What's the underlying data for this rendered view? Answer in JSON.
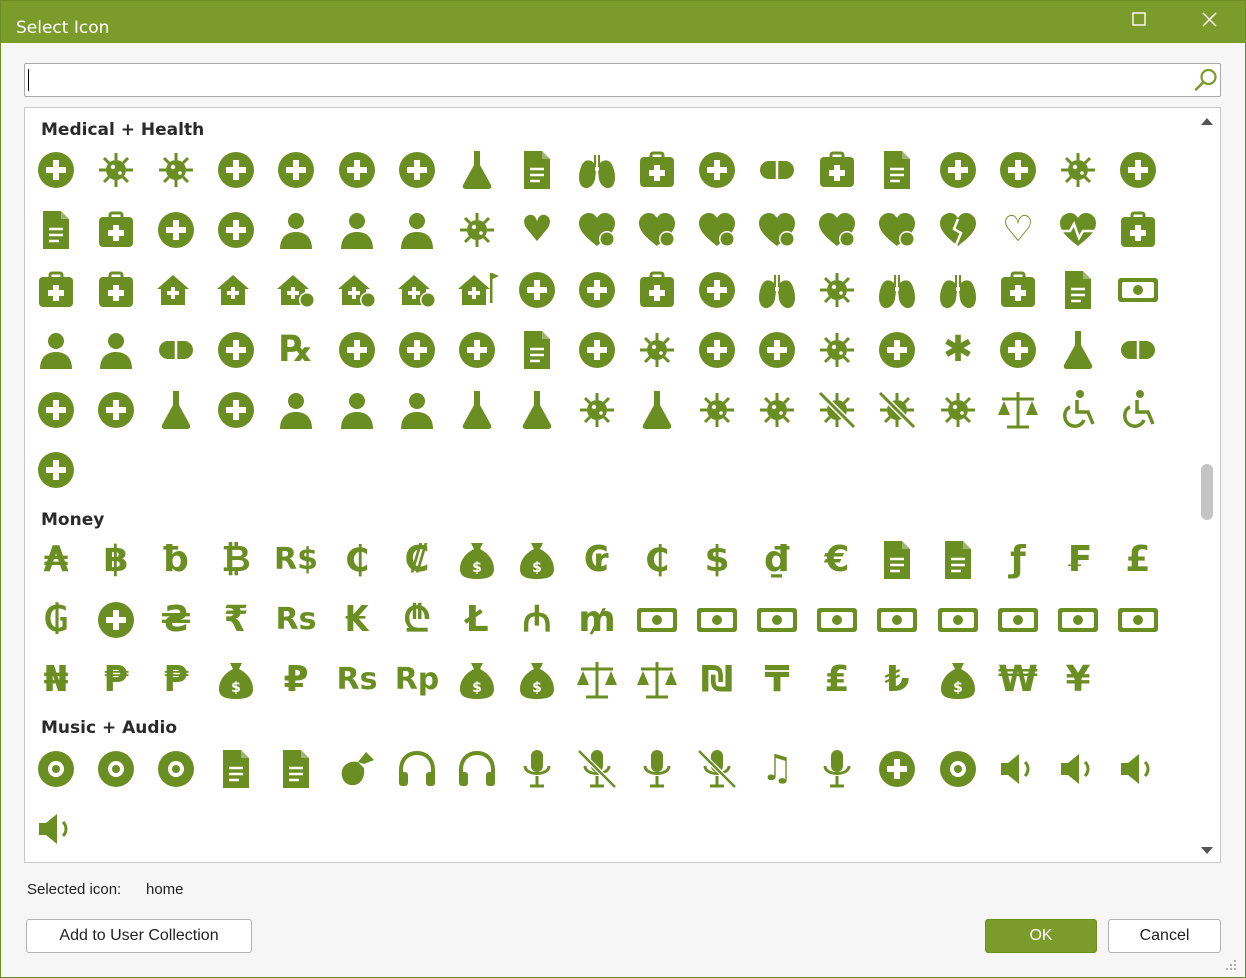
{
  "window": {
    "title": "Select Icon"
  },
  "search": {
    "value": "",
    "placeholder": ""
  },
  "colors": {
    "accent": "#7b9b2a",
    "icon": "#6b8e23"
  },
  "sections": [
    {
      "title": "Medical + Health",
      "icons": [
        "ambulance",
        "bacteria",
        "bacterium",
        "ban-smoking",
        "band-aid",
        "bed-pulse",
        "biohazard",
        "flask-vial",
        "book-medical",
        "brain",
        "briefcase-medical",
        "cannabis",
        "capsules",
        "hospital-h-circle",
        "clipboard-user",
        "comment-medical",
        "crutch",
        "virus-star",
        "dna",
        "file-prescription",
        "square-h",
        "hand-dots",
        "hand-holding-medical",
        "head-side-cough",
        "head-side-cough-slash",
        "head-side-mask",
        "head-side-virus",
        "heart",
        "heart-bolt",
        "heart-check",
        "heart-exclamation",
        "heart-minus",
        "heart-plus",
        "heart-xmark",
        "heart-crack",
        "heart-outline",
        "heart-pulse",
        "hospital",
        "hospital-outline",
        "hospital-user",
        "house-chimney-medical",
        "house-medical",
        "house-medical-circle-check",
        "house-medical-circle-exclamation",
        "house-medical-circle-xmark",
        "house-medical-flag",
        "id-card-clip",
        "joint",
        "kit-medical",
        "laptop-medical",
        "lungs",
        "lungs-virus",
        "mask-face",
        "mask-ventilator",
        "suitcase-medical",
        "notes-medical",
        "credit-card-medical",
        "person-breastfeeding",
        "person-dots-from-line",
        "pills",
        "poop",
        "prescription",
        "prescription-bottle",
        "prescription-bottle-medical",
        "pump-medical",
        "receipt",
        "ribbon",
        "shield-virus",
        "skull",
        "smoking",
        "square-virus",
        "staff-snake",
        "star-of-life",
        "stethoscope",
        "syringe",
        "tablets",
        "teeth",
        "teeth-open",
        "thermometer",
        "tooth",
        "user-injured",
        "user-doctor",
        "user-nurse",
        "vial",
        "vial-circle-check",
        "vial-virus",
        "vials",
        "virus",
        "virus-covid",
        "virus-slash",
        "virus-covid-slash",
        "viruses",
        "weight-scale",
        "wheelchair",
        "wheelchair-move",
        "x-ray"
      ]
    },
    {
      "title": "Money",
      "icons": [
        "austral-sign",
        "baht-sign",
        "bitcoin-sign-alt",
        "bitcoin-sign",
        "brazilian-real-sign",
        "cedi-sign",
        "colon-sign",
        "sack-dollar-circle",
        "coins",
        "cruzeiro-sign",
        "cent-sign",
        "dollar-sign",
        "dong-sign",
        "euro-sign",
        "file-invoice",
        "file-invoice-dollar",
        "florin-sign",
        "franc-sign",
        "sterling-sign",
        "guarani-sign",
        "hand-holding-dollar",
        "hryvnia-sign",
        "indian-rupee-sign",
        "rupee-sign",
        "kip-sign",
        "lari-sign",
        "litecoin-sign",
        "manat-sign",
        "mill-sign",
        "money-bill",
        "money-bill-wave",
        "money-bill-transfer",
        "money-bill-trend-up",
        "money-bill-wheat",
        "money-bill-1-wave",
        "money-bills",
        "money-check",
        "money-check-dollar",
        "naira-sign",
        "peso-sign",
        "philippine-peso-sign",
        "piggy-bank",
        "ruble-sign",
        "rupee-sign-text",
        "rupiah-sign",
        "sack-dollar",
        "sack-xmark",
        "scale-balanced",
        "scale-unbalanced",
        "shekel-sign",
        "tenge-sign",
        "lira-sign",
        "turkish-lira-sign",
        "wallet",
        "won-sign",
        "yen-sign"
      ]
    },
    {
      "title": "Music + Audio",
      "icons": [
        "compact-disc",
        "drum",
        "drum-steelpan",
        "file-audio",
        "file-audio-outline",
        "guitar",
        "headphones",
        "headphones-simple",
        "microphone",
        "microphone-slash",
        "microphone-lines",
        "microphone-lines-slash",
        "music",
        "podcast",
        "radio",
        "record-vinyl",
        "volume-low",
        "volume-off",
        "volume-high",
        "volume-xmark"
      ]
    }
  ],
  "glyphs": {
    "austral-sign": "₳",
    "baht-sign": "฿",
    "bitcoin-sign-alt": "ƀ",
    "bitcoin-sign": "₿",
    "brazilian-real-sign": "R$",
    "cedi-sign": "₵",
    "colon-sign": "₡",
    "cruzeiro-sign": "₢",
    "cent-sign": "₵",
    "dollar-sign": "$",
    "dong-sign": "₫",
    "euro-sign": "€",
    "florin-sign": "ƒ",
    "franc-sign": "₣",
    "sterling-sign": "£",
    "guarani-sign": "₲",
    "hryvnia-sign": "₴",
    "indian-rupee-sign": "₹",
    "rupee-sign": "Rs",
    "kip-sign": "₭",
    "lari-sign": "₾",
    "litecoin-sign": "Ł",
    "manat-sign": "₼",
    "mill-sign": "₥",
    "naira-sign": "₦",
    "peso-sign": "₱",
    "philippine-peso-sign": "₱",
    "ruble-sign": "₽",
    "rupee-sign-text": "Rs",
    "rupiah-sign": "Rp",
    "shekel-sign": "₪",
    "tenge-sign": "₸",
    "lira-sign": "₤",
    "turkish-lira-sign": "₺",
    "won-sign": "₩",
    "yen-sign": "¥",
    "prescription": "℞",
    "music": "♫",
    "heart": "♥",
    "heart-outline": "♡",
    "star-of-life": "✱"
  },
  "status": {
    "label": "Selected icon:",
    "value": "home"
  },
  "buttons": {
    "add": "Add to User Collection",
    "ok": "OK",
    "cancel": "Cancel"
  }
}
